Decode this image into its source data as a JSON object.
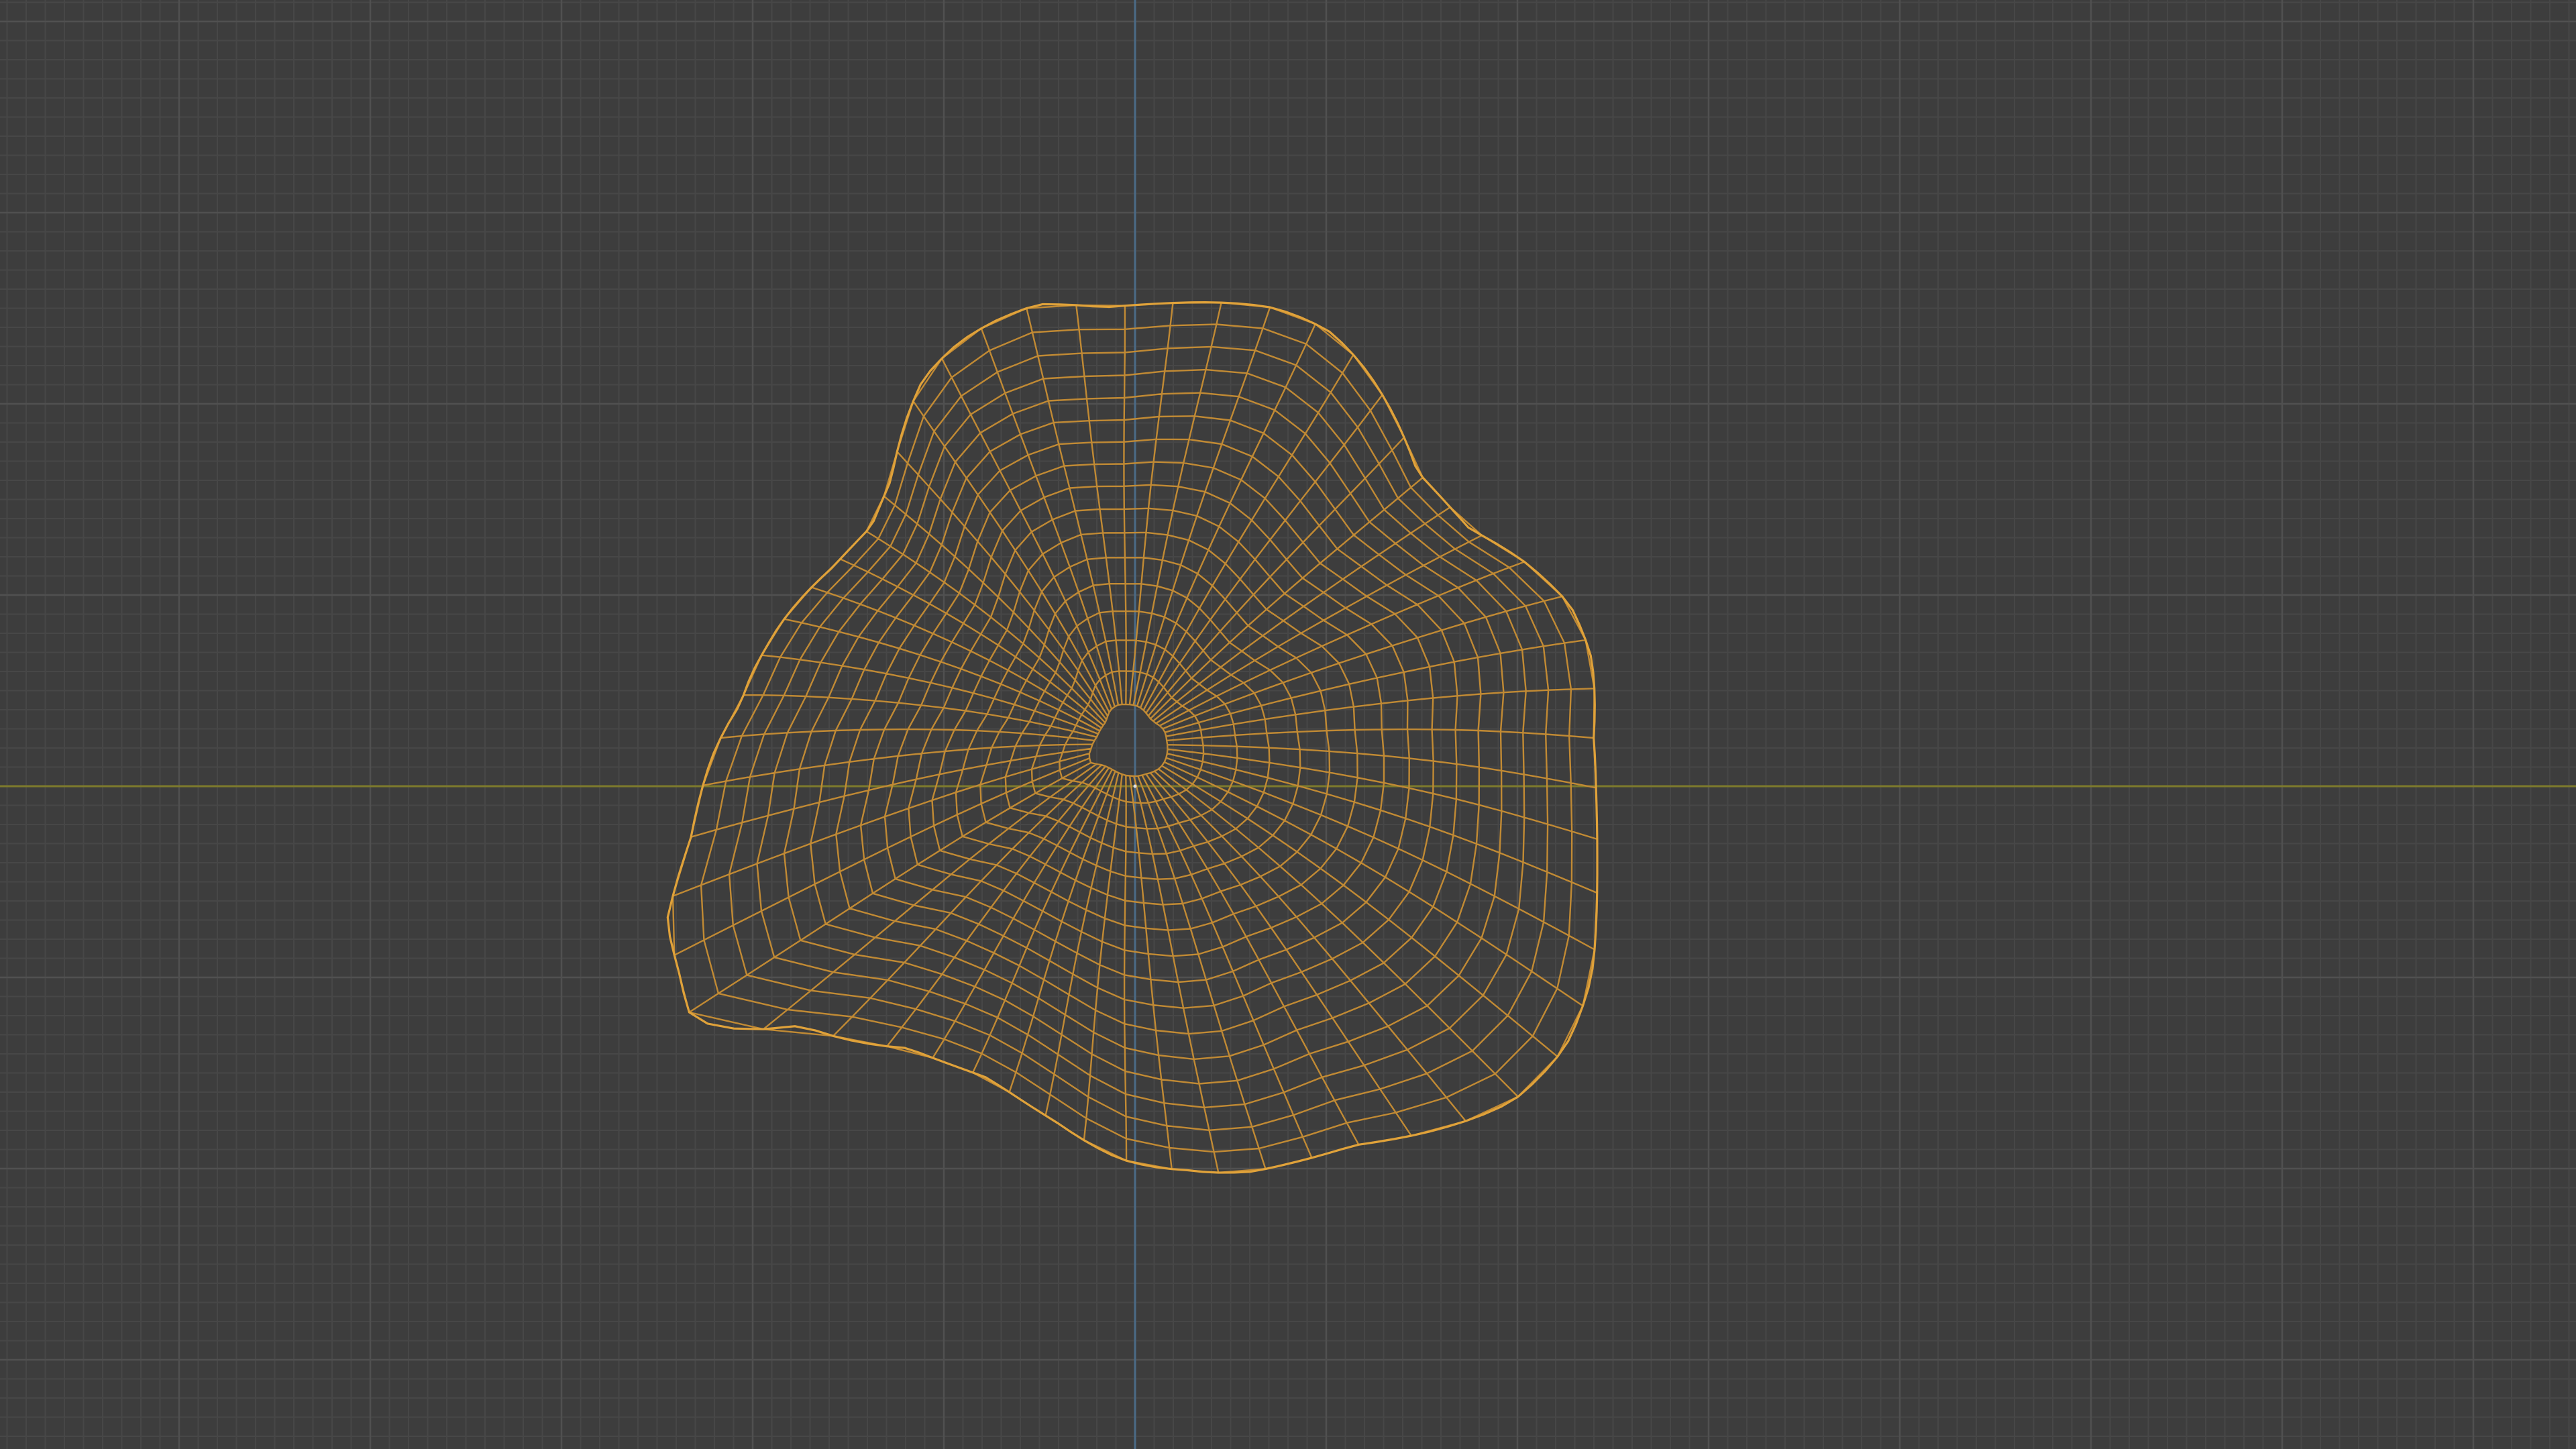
{
  "viewport": {
    "view_mode": "wireframe",
    "background_color": "#3d3d3d",
    "grid_minor_color": "#474747",
    "grid_major_color": "#505050",
    "x_axis_color": "#7d7a2c",
    "y_axis_color": "#4b6a86",
    "wire_color": "#c18a34",
    "wire_edge_color": "#e0a23a",
    "origin_color": "#e0e0e0"
  },
  "object": {
    "kind": "mesh",
    "state": "selected",
    "shape": "rock"
  }
}
